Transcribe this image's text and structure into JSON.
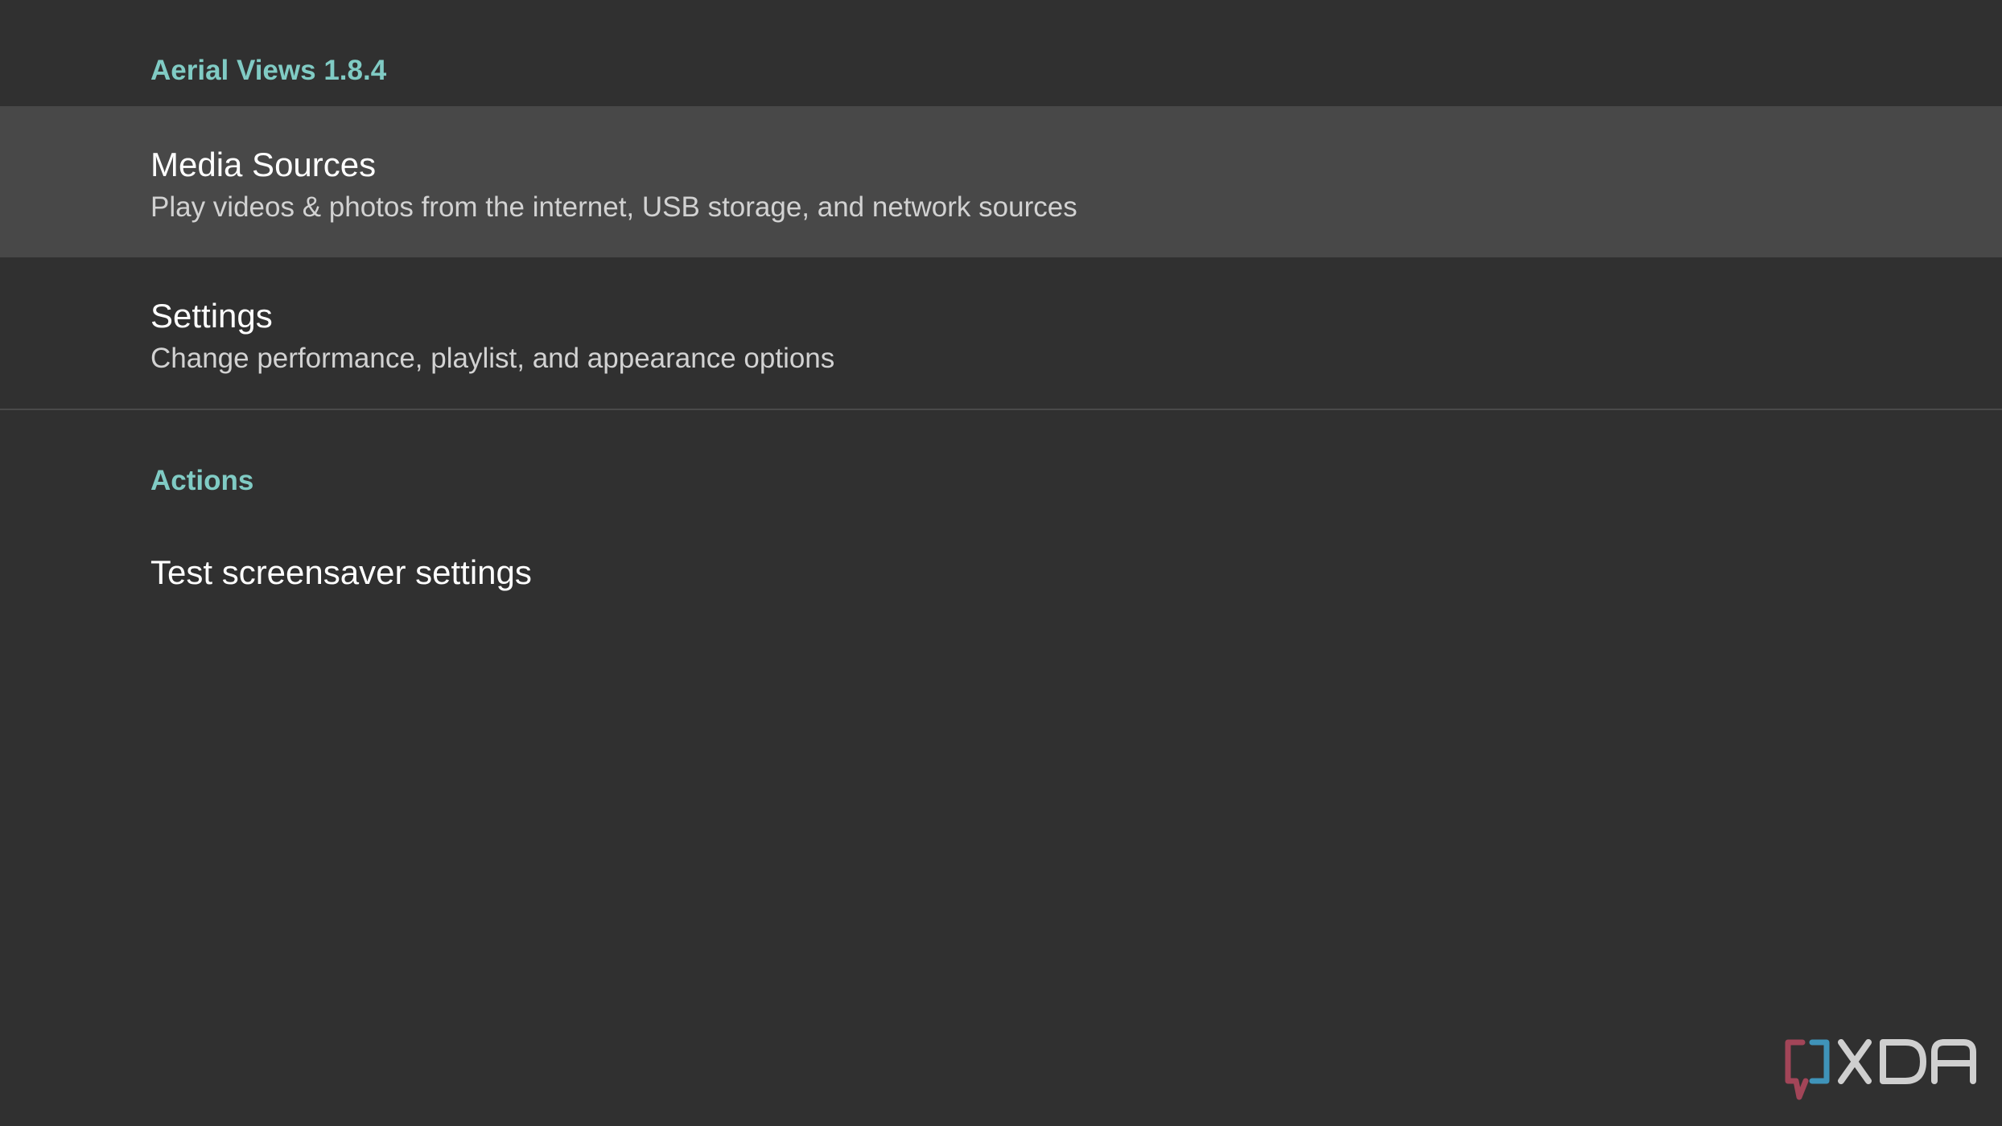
{
  "app_header": {
    "title": "Aerial Views 1.8.4"
  },
  "preferences": [
    {
      "title": "Media Sources",
      "summary": "Play videos & photos from the internet, USB storage, and network sources",
      "focused": true
    },
    {
      "title": "Settings",
      "summary": "Change performance, playlist, and appearance options",
      "focused": false
    }
  ],
  "actions": {
    "header": "Actions",
    "items": [
      {
        "title": "Test screensaver settings"
      }
    ]
  },
  "watermark": {
    "text": "XDA",
    "icon": "xda-logo-icon"
  },
  "colors": {
    "background": "#303030",
    "focused_row": "#484848",
    "accent": "#80cbc4",
    "title_text": "#ffffff",
    "summary_text": "#d2d2d2"
  }
}
